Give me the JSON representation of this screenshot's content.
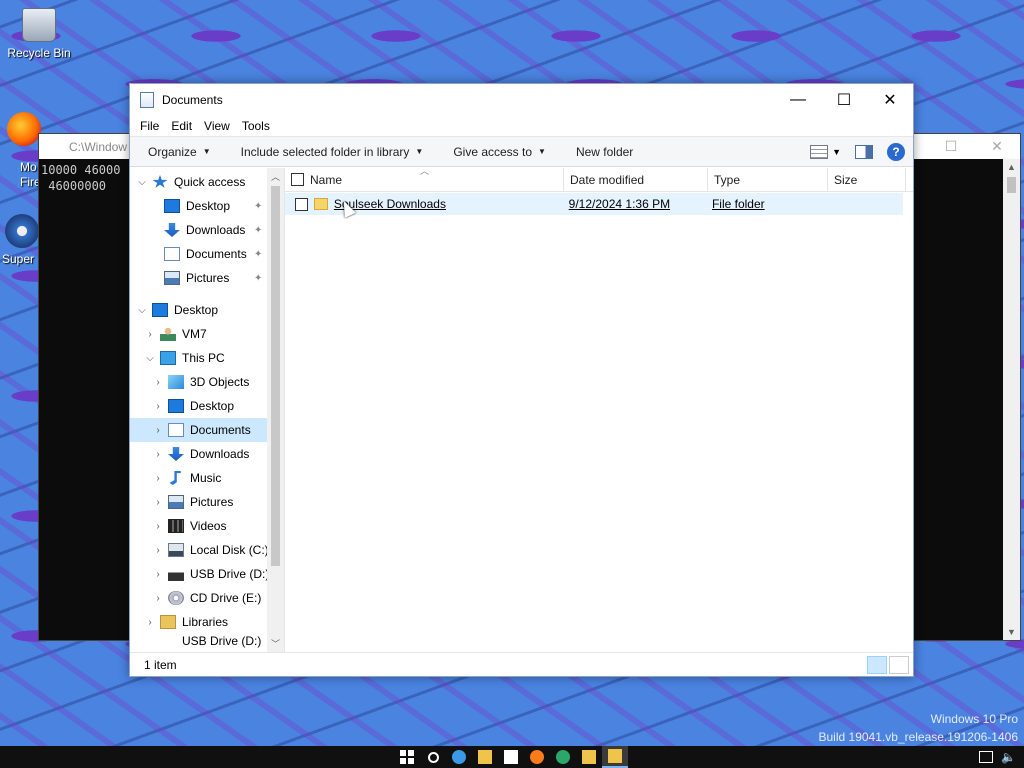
{
  "desktop": {
    "icons": [
      {
        "label": "Recycle Bin"
      },
      {
        "label": "Mo\nFire"
      },
      {
        "label": "Super"
      }
    ],
    "watermark": {
      "line1": "Windows 10 Pro",
      "line2": "Build 19041.vb_release.191206-1406"
    }
  },
  "console": {
    "title": "C:\\Window",
    "lines": "10000 46000\n 46000000"
  },
  "explorer": {
    "title": "Documents",
    "menu": [
      "File",
      "Edit",
      "View",
      "Tools"
    ],
    "commands": {
      "organize": "Organize",
      "include": "Include selected folder in library",
      "give_access": "Give access to",
      "new_folder": "New folder"
    },
    "nav": [
      {
        "label": "Quick access",
        "icon": "star-icon"
      },
      {
        "label": "Desktop",
        "icon": "desktop-icon",
        "pinned": true
      },
      {
        "label": "Downloads",
        "icon": "downloads-icon",
        "pinned": true
      },
      {
        "label": "Documents",
        "icon": "documents-icon",
        "pinned": true
      },
      {
        "label": "Pictures",
        "icon": "pictures-icon",
        "pinned": true
      },
      {
        "label": "Desktop",
        "icon": "desktop-icon"
      },
      {
        "label": "VM7",
        "icon": "user-icon"
      },
      {
        "label": "This PC",
        "icon": "pc-icon"
      },
      {
        "label": "3D Objects",
        "icon": "3d-objects-icon"
      },
      {
        "label": "Desktop",
        "icon": "desktop-icon"
      },
      {
        "label": "Documents",
        "icon": "documents-icon",
        "selected": true
      },
      {
        "label": "Downloads",
        "icon": "downloads-icon"
      },
      {
        "label": "Music",
        "icon": "music-icon"
      },
      {
        "label": "Pictures",
        "icon": "pictures-icon"
      },
      {
        "label": "Videos",
        "icon": "videos-icon"
      },
      {
        "label": "Local Disk (C:)",
        "icon": "local-disk-icon"
      },
      {
        "label": "USB Drive (D:)",
        "icon": "usb-drive-icon"
      },
      {
        "label": "CD Drive (E:)",
        "icon": "cd-drive-icon"
      },
      {
        "label": "Libraries",
        "icon": "libraries-icon"
      },
      {
        "label": "USB Drive (D:)",
        "icon": "usb-drive-icon"
      }
    ],
    "columns": {
      "name": "Name",
      "date": "Date modified",
      "type": "Type",
      "size": "Size"
    },
    "files": [
      {
        "name": "Soulseek Downloads",
        "date": "9/12/2024 1:36 PM",
        "type": "File folder",
        "size": ""
      }
    ],
    "status": "1 item"
  }
}
